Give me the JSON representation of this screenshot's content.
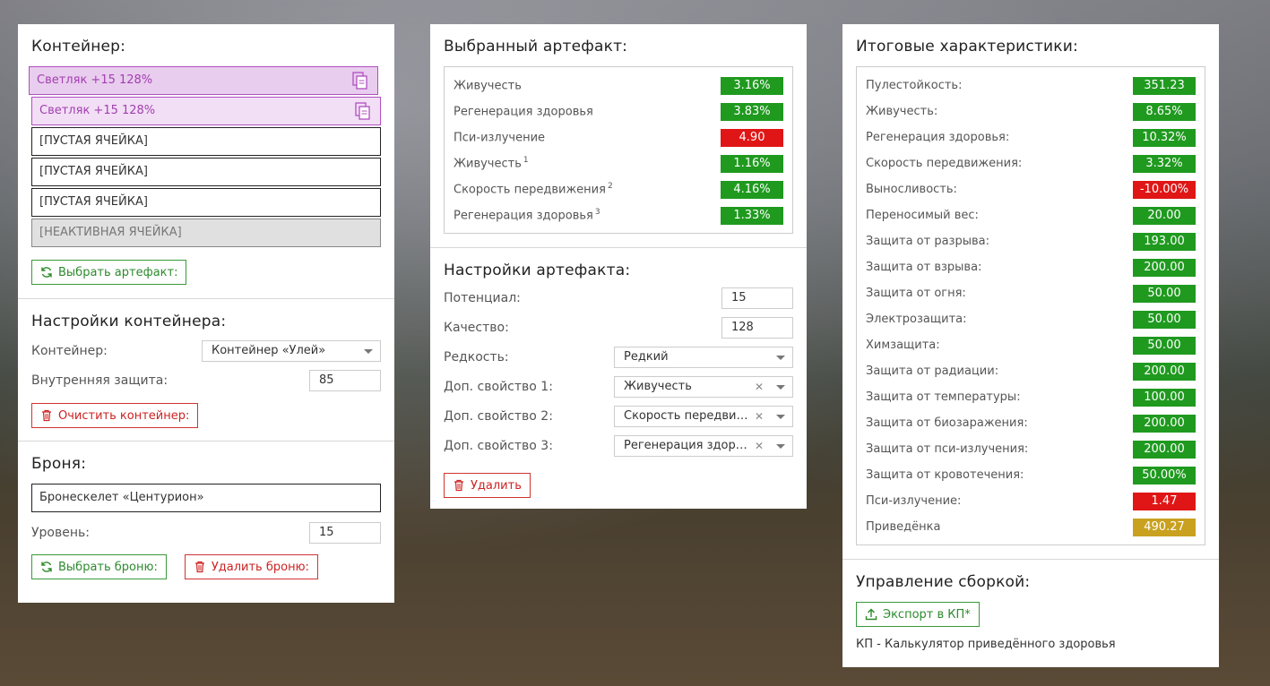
{
  "container_panel": {
    "title": "Контейнер:",
    "slots": [
      {
        "label": "Светляк +15 128%",
        "kind": "artifact"
      },
      {
        "label": "Светляк +15 128%",
        "kind": "artifact"
      },
      {
        "label": "[ПУСТАЯ ЯЧЕЙКА]",
        "kind": "empty"
      },
      {
        "label": "[ПУСТАЯ ЯЧЕЙКА]",
        "kind": "empty"
      },
      {
        "label": "[ПУСТАЯ ЯЧЕЙКА]",
        "kind": "empty"
      },
      {
        "label": "[НЕАКТИВНАЯ ЯЧЕЙКА]",
        "kind": "inactive"
      }
    ],
    "select_artifact_button": "Выбрать артефакт:"
  },
  "container_settings": {
    "title": "Настройки контейнера:",
    "container_label": "Контейнер:",
    "container_value": "Контейнер «Улей»",
    "inner_protection_label": "Внутренняя защита:",
    "inner_protection_value": "85",
    "clear_button": "Очистить контейнер:"
  },
  "armor": {
    "title": "Броня:",
    "name": "Бронескелет «Центурион»",
    "level_label": "Уровень:",
    "level_value": "15",
    "select_button": "Выбрать броню:",
    "delete_button": "Удалить броню:"
  },
  "selected_artifact": {
    "title": "Выбранный артефакт:",
    "stats": [
      {
        "label": "Живучесть",
        "sup": "",
        "value": "3.16%",
        "color": "green"
      },
      {
        "label": "Регенерация здоровья",
        "sup": "",
        "value": "3.83%",
        "color": "green"
      },
      {
        "label": "Пси-излучение",
        "sup": "",
        "value": "4.90",
        "color": "red"
      },
      {
        "label": "Живучесть",
        "sup": "1",
        "value": "1.16%",
        "color": "green"
      },
      {
        "label": "Скорость передвижения",
        "sup": "2",
        "value": "4.16%",
        "color": "green"
      },
      {
        "label": "Регенерация здоровья",
        "sup": "3",
        "value": "1.33%",
        "color": "green"
      }
    ]
  },
  "artifact_settings": {
    "title": "Настройки артефакта:",
    "potential_label": "Потенциал:",
    "potential_value": "15",
    "quality_label": "Качество:",
    "quality_value": "128",
    "rarity_label": "Редкость:",
    "rarity_value": "Редкий",
    "extra1_label": "Доп. свойство 1:",
    "extra1_value": "Живучесть",
    "extra2_label": "Доп. свойство 2:",
    "extra2_value": "Скорость передвижения",
    "extra3_label": "Доп. свойство 3:",
    "extra3_value": "Регенерация здоровья",
    "delete_button": "Удалить"
  },
  "totals": {
    "title": "Итоговые характеристики:",
    "stats": [
      {
        "label": "Пулестойкость:",
        "value": "351.23",
        "color": "green"
      },
      {
        "label": "Живучесть:",
        "value": "8.65%",
        "color": "green"
      },
      {
        "label": "Регенерация здоровья:",
        "value": "10.32%",
        "color": "green"
      },
      {
        "label": "Скорость передвижения:",
        "value": "3.32%",
        "color": "green"
      },
      {
        "label": "Выносливость:",
        "value": "-10.00%",
        "color": "red"
      },
      {
        "label": "Переносимый вес:",
        "value": "20.00",
        "color": "green"
      },
      {
        "label": "Защита от разрыва:",
        "value": "193.00",
        "color": "green"
      },
      {
        "label": "Защита от взрыва:",
        "value": "200.00",
        "color": "green"
      },
      {
        "label": "Защита от огня:",
        "value": "50.00",
        "color": "green"
      },
      {
        "label": "Электрозащита:",
        "value": "50.00",
        "color": "green"
      },
      {
        "label": "Химзащита:",
        "value": "50.00",
        "color": "green"
      },
      {
        "label": "Защита от радиации:",
        "value": "200.00",
        "color": "green"
      },
      {
        "label": "Защита от температуры:",
        "value": "100.00",
        "color": "green"
      },
      {
        "label": "Защита от биозаражения:",
        "value": "200.00",
        "color": "green"
      },
      {
        "label": "Защита от пси-излучения:",
        "value": "200.00",
        "color": "green"
      },
      {
        "label": "Защита от кровотечения:",
        "value": "50.00%",
        "color": "green"
      },
      {
        "label": "Пси-излучение:",
        "value": "1.47",
        "color": "red"
      },
      {
        "label": "Приведёнка",
        "value": "490.27",
        "color": "yellow"
      }
    ]
  },
  "build_management": {
    "title": "Управление сборкой:",
    "export_button": "Экспорт в КП*",
    "footnote": "КП - Калькулятор приведённого здоровья"
  },
  "colors": {
    "green": "#1f9a1f",
    "red": "#e01616",
    "yellow": "#c9a11e",
    "artifact_purple": "#b04fbf"
  }
}
